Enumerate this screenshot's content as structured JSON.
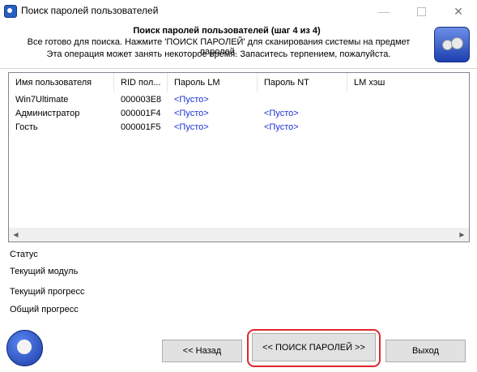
{
  "window": {
    "title": "Поиск паролей пользователей",
    "min_icon": "—",
    "close_icon": "✕"
  },
  "header": {
    "title": "Поиск паролей пользователей (шаг 4 из 4)",
    "line1": "Все готово для поиска. Нажмите 'ПОИСК ПАРОЛЕЙ' для сканирования системы на предмет паролей.",
    "line2": "Эта операция может занять некоторое время. Запаситесь терпением, пожалуйста."
  },
  "table": {
    "columns": [
      "Имя пользователя",
      "RID пол...",
      "Пароль LM",
      "Пароль NT",
      "LM хэш"
    ],
    "rows": [
      {
        "user": "Win7Ultimate",
        "rid": "000003E8",
        "lm": "<Пусто>",
        "nt": ""
      },
      {
        "user": "Администратор",
        "rid": "000001F4",
        "lm": "<Пусто>",
        "nt": "<Пусто>"
      },
      {
        "user": "Гость",
        "rid": "000001F5",
        "lm": "<Пусто>",
        "nt": "<Пусто>"
      }
    ],
    "scroll_left": "◀",
    "scroll_right": "▶"
  },
  "status": {
    "status_label": "Статус",
    "module_label": "Текущий модуль",
    "current_progress_label": "Текущий прогресс",
    "total_progress_label": "Общий прогресс"
  },
  "buttons": {
    "back": "<< Назад",
    "search": "<< ПОИСК ПАРОЛЕЙ >>",
    "exit": "Выход"
  },
  "colors": {
    "link_blue": "#1a2fd6",
    "highlight_red": "#e0262e"
  }
}
